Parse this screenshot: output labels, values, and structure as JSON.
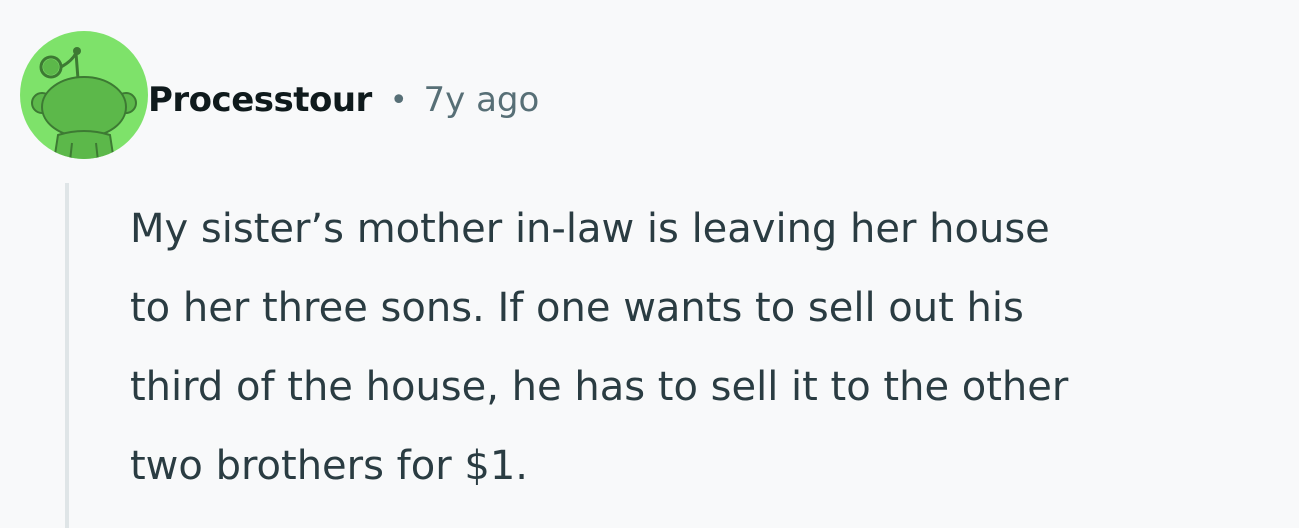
{
  "comment": {
    "author": "Processtour",
    "separator": "•",
    "timestamp": "7y ago",
    "avatar_icon": "reddit-snoo-avatar-icon",
    "avatar_color": "#7ee26a",
    "body_lines": [
      "My sister’s mother in-law is leaving her house",
      "to her three sons. If one wants to sell out his",
      "third of the house, he has to sell it to the other",
      "two brothers for $1."
    ]
  }
}
